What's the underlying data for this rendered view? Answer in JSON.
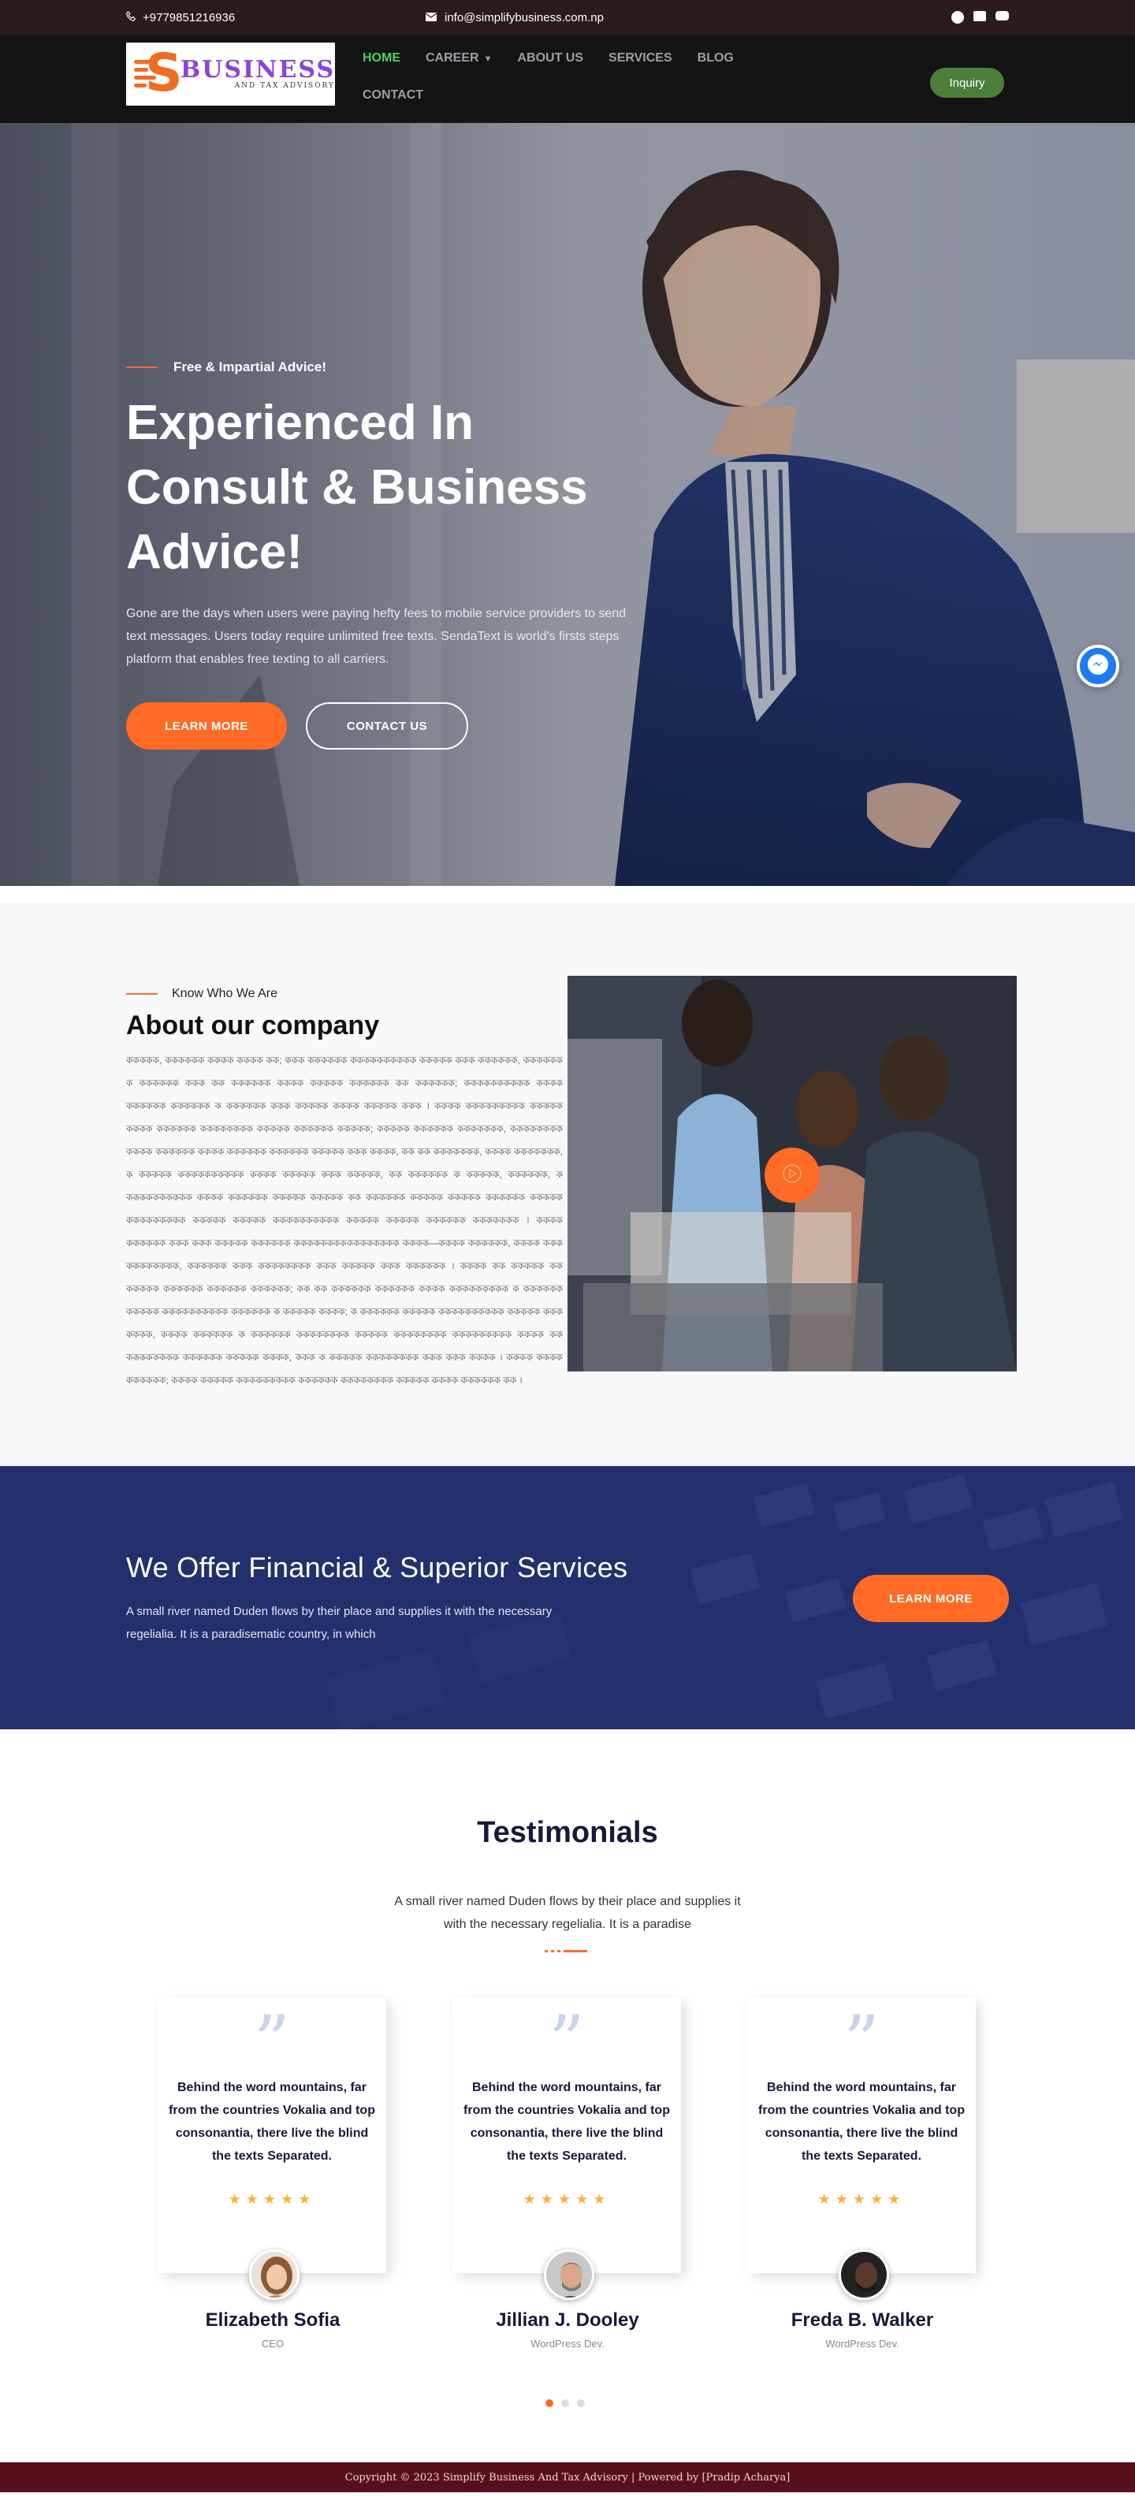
{
  "topbar": {
    "phone": "+9779851216936",
    "email": "info@simplifybusiness.com.np",
    "social": [
      "facebook-icon",
      "twitter-icon",
      "youtube-icon"
    ]
  },
  "nav": {
    "logo_title": "BUSINESS",
    "logo_subtitle": "AND TAX ADVISORY",
    "items": [
      {
        "label": "HOME",
        "active": true
      },
      {
        "label": "CAREER",
        "dropdown": true
      },
      {
        "label": "ABOUT US"
      },
      {
        "label": "SERVICES"
      },
      {
        "label": "BLOG"
      },
      {
        "label": "CONTACT"
      }
    ],
    "inquiry_label": "Inquiry"
  },
  "hero": {
    "kicker": "Free & Impartial Advice!",
    "heading": "Experienced In Consult & Business Advice!",
    "text": "Gone are the days when users were paying hefty fees to mobile service providers to send text messages. Users today require unlimited free texts. SendaText is world's firsts steps platform that enables free texting to all carriers.",
    "btn_primary": "LEARN MORE",
    "btn_secondary": "CONTACT US"
  },
  "about": {
    "kicker": "Know Who We Are",
    "heading": "About our company",
    "body": "ককককক, কককককক কককক কককক কক; ককক কককককক কককককককককক ককককক ককক কককককক, কককককক ক কককককক ককক কক কককককক কককক ককককক কককককক কক কককককক; কককককককককক কককক কককককক কককককক ক কককককক ককক ককককক কককক ককককক ককক । কককক ককককককককক ককককক কককক কককককক কককককককক ককককক কককককক ককককক; ককককক কককককক ককককককক, কককককককক কককক কককককক কককক কককককক কককককক ককককক ককক কককক, কক কক ককককককক, কককক ককককককক, ক ককককক কককককককককক কককক ককককক ককক ককককক, কক কককককক ক ককককক, কককককক, ক কককককককককক কককক কককককক ককককক ককককক কক কককককক ককককক ককককক কককককক ককককক ককককককককক ককককক ককককক কককককককককক ককককক ককককক কককককক ককককককক । কককক কককককক ককক ককক ককককক কককককক কককককককককককককককক কককক—কককক কককককক, কককক ককক কককককককক, কককককক ককক কককককককক ককক ককককক ককক কককককক । কককক কক ককককক কক ককককক কককককক কককককক কককককক; কক কক কককককক কককককক কককক ককককককককক ক কককককক ককককক কককককককককক কককককক ক ককককক কককক; ক কককককক ককককক কককককককককক ককককক ককক কককক, কককক কককককক ক কককককক কককককককক ককককক কককককককক ককককককককক কককক কক কককককককক কককককক ককককক কককক, ককক ক ককককক কককককককক ককক ককক কককক । কককক কককক কককককক; কককক ককককক ককককককককক কককককক কককককককক ককককক কককক কককককক কক ।"
  },
  "services": {
    "heading": "We Offer Financial & Superior Services",
    "text": "A small river named Duden flows by their place and supplies it with the necessary regelialia. It is a paradisematic country, in which",
    "button": "LEARN MORE"
  },
  "testimonials": {
    "heading": "Testimonials",
    "subtext": "A small river named Duden flows by their place and supplies it with the necessary regelialia. It is a paradise",
    "items": [
      {
        "quote": "Behind the word mountains, far from the countries Vokalia and top consonantia, there live the blind the texts Separated.",
        "stars": "★★★★★",
        "name": "Elizabeth Sofia",
        "role": "CEO"
      },
      {
        "quote": "Behind the word mountains, far from the countries Vokalia and top consonantia, there live the blind the texts Separated.",
        "stars": "★★★★★",
        "name": "Jillian J. Dooley",
        "role": "WordPress Dev."
      },
      {
        "quote": "Behind the word mountains, far from the countries Vokalia and top consonantia, there live the blind the texts Separated.",
        "stars": "★★★★★",
        "name": "Freda B. Walker",
        "role": "WordPress Dev."
      }
    ]
  },
  "footer": {
    "text": "Copyright © 2023 Simplify Business And Tax Advisory | Powered by [Pradip Acharya]"
  },
  "colors": {
    "accent": "#ff6b24",
    "nav_active": "#4cd25e",
    "banner_bg": "#242f6e",
    "footer_bg": "#571019",
    "inquiry_bg": "#4c7f3a"
  }
}
